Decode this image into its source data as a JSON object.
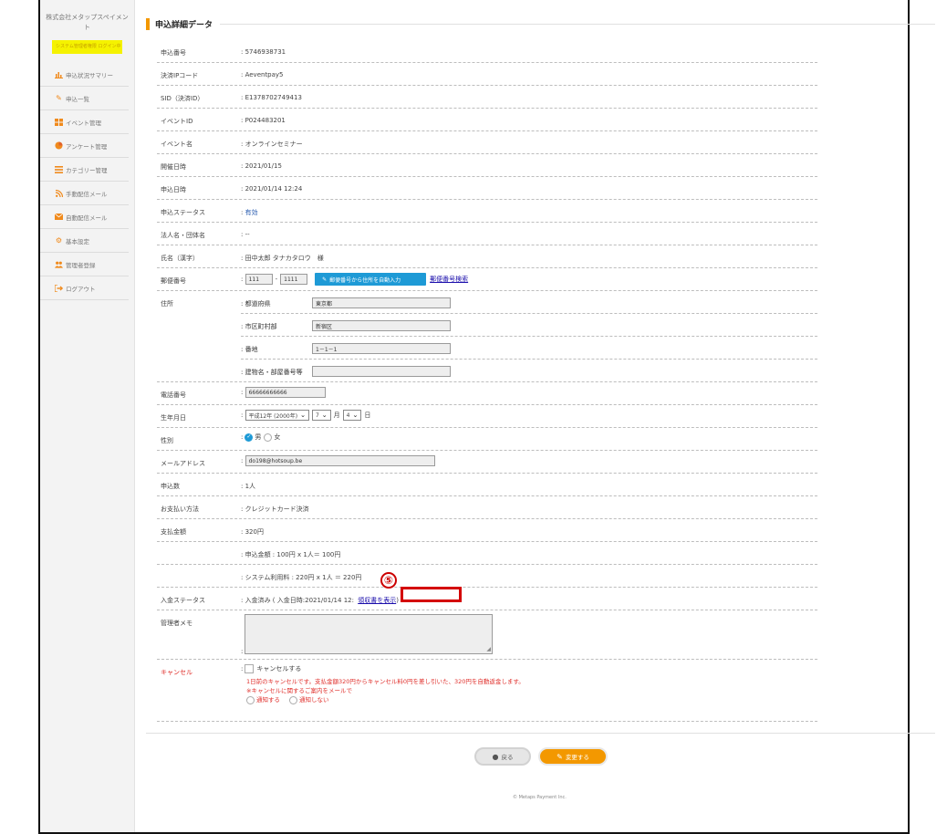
{
  "sidebar": {
    "company": "株式会社メタップスペイメント",
    "login_badge": "システム管理者権限 ログイン中",
    "items": [
      {
        "label": "申込状況サマリー",
        "icon": "bar-chart-icon"
      },
      {
        "label": "申込一覧",
        "icon": "pencil-icon"
      },
      {
        "label": "イベント管理",
        "icon": "grid-icon"
      },
      {
        "label": "アンケート管理",
        "icon": "pie-chart-icon"
      },
      {
        "label": "カテゴリー管理",
        "icon": "list-icon"
      },
      {
        "label": "手動配信メール",
        "icon": "rss-icon"
      },
      {
        "label": "自動配信メール",
        "icon": "envelope-icon"
      },
      {
        "label": "基本設定",
        "icon": "gears-icon"
      },
      {
        "label": "管理者登録",
        "icon": "users-icon"
      },
      {
        "label": "ログアウト",
        "icon": "sign-out-icon"
      }
    ]
  },
  "page": {
    "title": "申込詳細データ"
  },
  "fields": {
    "application_no": {
      "label": "申込番号",
      "value": ": 5746938731"
    },
    "payment_ip": {
      "label": "決済IPコード",
      "value": ": Aeventpay5"
    },
    "sid": {
      "label": "SID（決済ID）",
      "value": ": E1378702749413"
    },
    "event_id": {
      "label": "イベントID",
      "value": ": P024483201"
    },
    "event_name": {
      "label": "イベント名",
      "value": ": オンラインセミナー"
    },
    "event_date": {
      "label": "開催日時",
      "value": ": 2021/01/15"
    },
    "applied_at": {
      "label": "申込日時",
      "value": ": 2021/01/14 12:24"
    },
    "status": {
      "label": "申込ステータス",
      "prefix": ":",
      "value": "有効"
    },
    "corporate": {
      "label": "法人名・団体名",
      "value": ": --"
    },
    "name": {
      "label": "氏名（漢字）",
      "value": ": 田中太郎 タナカタロウ　様"
    },
    "postal": {
      "label": "郵便番号",
      "prefix": ":",
      "part1": "111",
      "part2": "1111",
      "autofill_button": "郵便番号から住所を自動入力",
      "search_link": "郵便番号検索"
    },
    "address": {
      "label": "住所",
      "prefecture_label": ": 都道府県",
      "prefecture": "東京都",
      "city_label": ": 市区町村部",
      "city": "新宿区",
      "street_label": ": 番地",
      "street": "1－1－1",
      "building_label": ": 建物名・部屋番号等",
      "building": ""
    },
    "phone": {
      "label": "電話番号",
      "prefix": ":",
      "value": "66666666666"
    },
    "birthday": {
      "label": "生年月日",
      "prefix": ":",
      "year": "平成12年 (2000年)",
      "month": "7",
      "month_unit": "月",
      "day": "4",
      "day_unit": "日"
    },
    "gender": {
      "label": "性別",
      "prefix": ":",
      "male": "男",
      "female": "女",
      "selected": "男"
    },
    "email": {
      "label": "メールアドレス",
      "prefix": ":",
      "value": "do198@hotsoup.be"
    },
    "count": {
      "label": "申込数",
      "value": ": 1人"
    },
    "payment_method": {
      "label": "お支払い方法",
      "value": ": クレジットカード決済"
    },
    "amount": {
      "label": "支払金額",
      "value": ": 320円"
    },
    "amount_detail1": ": 申込金額 : 100円 x 1人＝ 100円",
    "amount_detail2": ": システム利用料 : 220円 x 1人 ＝ 220円",
    "deposit": {
      "label": "入金ステータス",
      "value": ": 入金済み ( 入金日時:2021/01/14 12:",
      "link": "領収書を表示"
    },
    "memo": {
      "label": "管理者メモ",
      "prefix": ":"
    },
    "cancel": {
      "label": "キャンセル",
      "prefix": ":",
      "checkbox_label": "キャンセルする",
      "note1": "1日前のキャンセルです。支払金額320円からキャンセル料0円を差し引いた、320円を自動返金します。",
      "note2": "※キャンセルに関するご案内をメールで",
      "notify": "通知する",
      "no_notify": "通知しない"
    }
  },
  "annotation": {
    "number": "⑤"
  },
  "buttons": {
    "back": "戻る",
    "change": "変更する"
  },
  "footer": {
    "copyright": "© Metaps Payment Inc."
  }
}
